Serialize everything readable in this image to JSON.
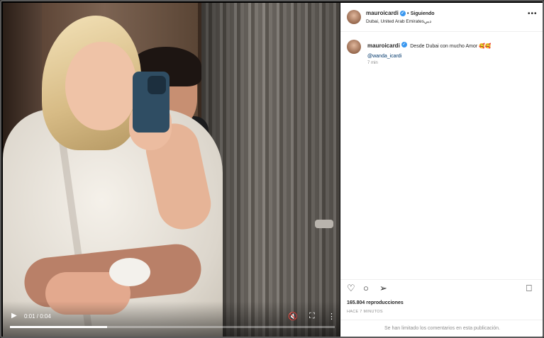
{
  "video": {
    "time": "0:01 / 0:04",
    "progress": 0.3,
    "play_icon": "play-icon",
    "mute_icon": "mute-icon",
    "fullscreen_icon": "fullscreen-icon",
    "more_icon": "more-icon"
  },
  "header": {
    "username": "mauroicardi",
    "separator": "•",
    "follow_status": "Siguiendo",
    "location": "Dubai, United Arab Emiratesدبي",
    "more_label": "•••"
  },
  "caption": {
    "username": "mauroicardi",
    "text": "Desde Dubai con mucho Amor 🥰🥰",
    "mention": "@wanda_icardi",
    "time": "7 min"
  },
  "actions": {
    "like_icon": "heart-icon",
    "comment_icon": "comment-icon",
    "share_icon": "share-icon",
    "save_icon": "bookmark-icon",
    "views": "165.804 reproducciones",
    "timestamp": "HACE 7 MINUTOS"
  },
  "comments": {
    "disabled_text": "Se han limitado los comentarios en esta publicación."
  },
  "colors": {
    "verified": "#3897f0",
    "mention": "#00376b",
    "text": "#262626",
    "muted": "#8e8e8e"
  }
}
